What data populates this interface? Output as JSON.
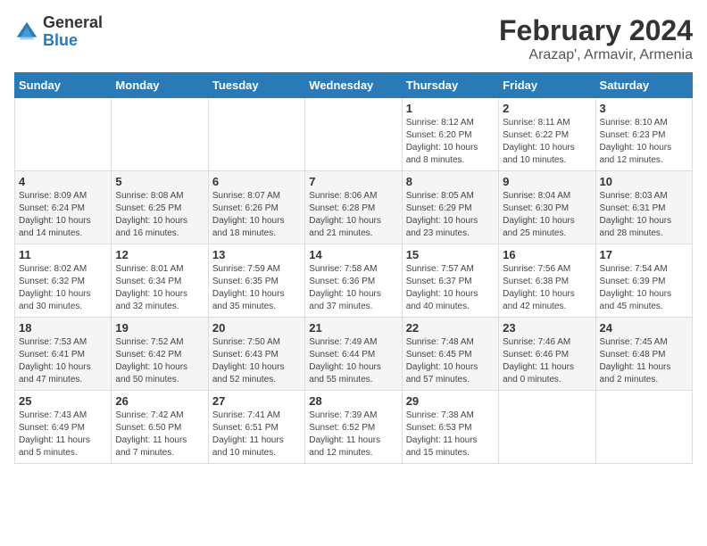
{
  "header": {
    "logo_general": "General",
    "logo_blue": "Blue",
    "title": "February 2024",
    "subtitle": "Arazap', Armavir, Armenia"
  },
  "calendar": {
    "days_of_week": [
      "Sunday",
      "Monday",
      "Tuesday",
      "Wednesday",
      "Thursday",
      "Friday",
      "Saturday"
    ],
    "weeks": [
      [
        {
          "day": "",
          "info": ""
        },
        {
          "day": "",
          "info": ""
        },
        {
          "day": "",
          "info": ""
        },
        {
          "day": "",
          "info": ""
        },
        {
          "day": "1",
          "info": "Sunrise: 8:12 AM\nSunset: 6:20 PM\nDaylight: 10 hours\nand 8 minutes."
        },
        {
          "day": "2",
          "info": "Sunrise: 8:11 AM\nSunset: 6:22 PM\nDaylight: 10 hours\nand 10 minutes."
        },
        {
          "day": "3",
          "info": "Sunrise: 8:10 AM\nSunset: 6:23 PM\nDaylight: 10 hours\nand 12 minutes."
        }
      ],
      [
        {
          "day": "4",
          "info": "Sunrise: 8:09 AM\nSunset: 6:24 PM\nDaylight: 10 hours\nand 14 minutes."
        },
        {
          "day": "5",
          "info": "Sunrise: 8:08 AM\nSunset: 6:25 PM\nDaylight: 10 hours\nand 16 minutes."
        },
        {
          "day": "6",
          "info": "Sunrise: 8:07 AM\nSunset: 6:26 PM\nDaylight: 10 hours\nand 18 minutes."
        },
        {
          "day": "7",
          "info": "Sunrise: 8:06 AM\nSunset: 6:28 PM\nDaylight: 10 hours\nand 21 minutes."
        },
        {
          "day": "8",
          "info": "Sunrise: 8:05 AM\nSunset: 6:29 PM\nDaylight: 10 hours\nand 23 minutes."
        },
        {
          "day": "9",
          "info": "Sunrise: 8:04 AM\nSunset: 6:30 PM\nDaylight: 10 hours\nand 25 minutes."
        },
        {
          "day": "10",
          "info": "Sunrise: 8:03 AM\nSunset: 6:31 PM\nDaylight: 10 hours\nand 28 minutes."
        }
      ],
      [
        {
          "day": "11",
          "info": "Sunrise: 8:02 AM\nSunset: 6:32 PM\nDaylight: 10 hours\nand 30 minutes."
        },
        {
          "day": "12",
          "info": "Sunrise: 8:01 AM\nSunset: 6:34 PM\nDaylight: 10 hours\nand 32 minutes."
        },
        {
          "day": "13",
          "info": "Sunrise: 7:59 AM\nSunset: 6:35 PM\nDaylight: 10 hours\nand 35 minutes."
        },
        {
          "day": "14",
          "info": "Sunrise: 7:58 AM\nSunset: 6:36 PM\nDaylight: 10 hours\nand 37 minutes."
        },
        {
          "day": "15",
          "info": "Sunrise: 7:57 AM\nSunset: 6:37 PM\nDaylight: 10 hours\nand 40 minutes."
        },
        {
          "day": "16",
          "info": "Sunrise: 7:56 AM\nSunset: 6:38 PM\nDaylight: 10 hours\nand 42 minutes."
        },
        {
          "day": "17",
          "info": "Sunrise: 7:54 AM\nSunset: 6:39 PM\nDaylight: 10 hours\nand 45 minutes."
        }
      ],
      [
        {
          "day": "18",
          "info": "Sunrise: 7:53 AM\nSunset: 6:41 PM\nDaylight: 10 hours\nand 47 minutes."
        },
        {
          "day": "19",
          "info": "Sunrise: 7:52 AM\nSunset: 6:42 PM\nDaylight: 10 hours\nand 50 minutes."
        },
        {
          "day": "20",
          "info": "Sunrise: 7:50 AM\nSunset: 6:43 PM\nDaylight: 10 hours\nand 52 minutes."
        },
        {
          "day": "21",
          "info": "Sunrise: 7:49 AM\nSunset: 6:44 PM\nDaylight: 10 hours\nand 55 minutes."
        },
        {
          "day": "22",
          "info": "Sunrise: 7:48 AM\nSunset: 6:45 PM\nDaylight: 10 hours\nand 57 minutes."
        },
        {
          "day": "23",
          "info": "Sunrise: 7:46 AM\nSunset: 6:46 PM\nDaylight: 11 hours\nand 0 minutes."
        },
        {
          "day": "24",
          "info": "Sunrise: 7:45 AM\nSunset: 6:48 PM\nDaylight: 11 hours\nand 2 minutes."
        }
      ],
      [
        {
          "day": "25",
          "info": "Sunrise: 7:43 AM\nSunset: 6:49 PM\nDaylight: 11 hours\nand 5 minutes."
        },
        {
          "day": "26",
          "info": "Sunrise: 7:42 AM\nSunset: 6:50 PM\nDaylight: 11 hours\nand 7 minutes."
        },
        {
          "day": "27",
          "info": "Sunrise: 7:41 AM\nSunset: 6:51 PM\nDaylight: 11 hours\nand 10 minutes."
        },
        {
          "day": "28",
          "info": "Sunrise: 7:39 AM\nSunset: 6:52 PM\nDaylight: 11 hours\nand 12 minutes."
        },
        {
          "day": "29",
          "info": "Sunrise: 7:38 AM\nSunset: 6:53 PM\nDaylight: 11 hours\nand 15 minutes."
        },
        {
          "day": "",
          "info": ""
        },
        {
          "day": "",
          "info": ""
        }
      ]
    ]
  }
}
